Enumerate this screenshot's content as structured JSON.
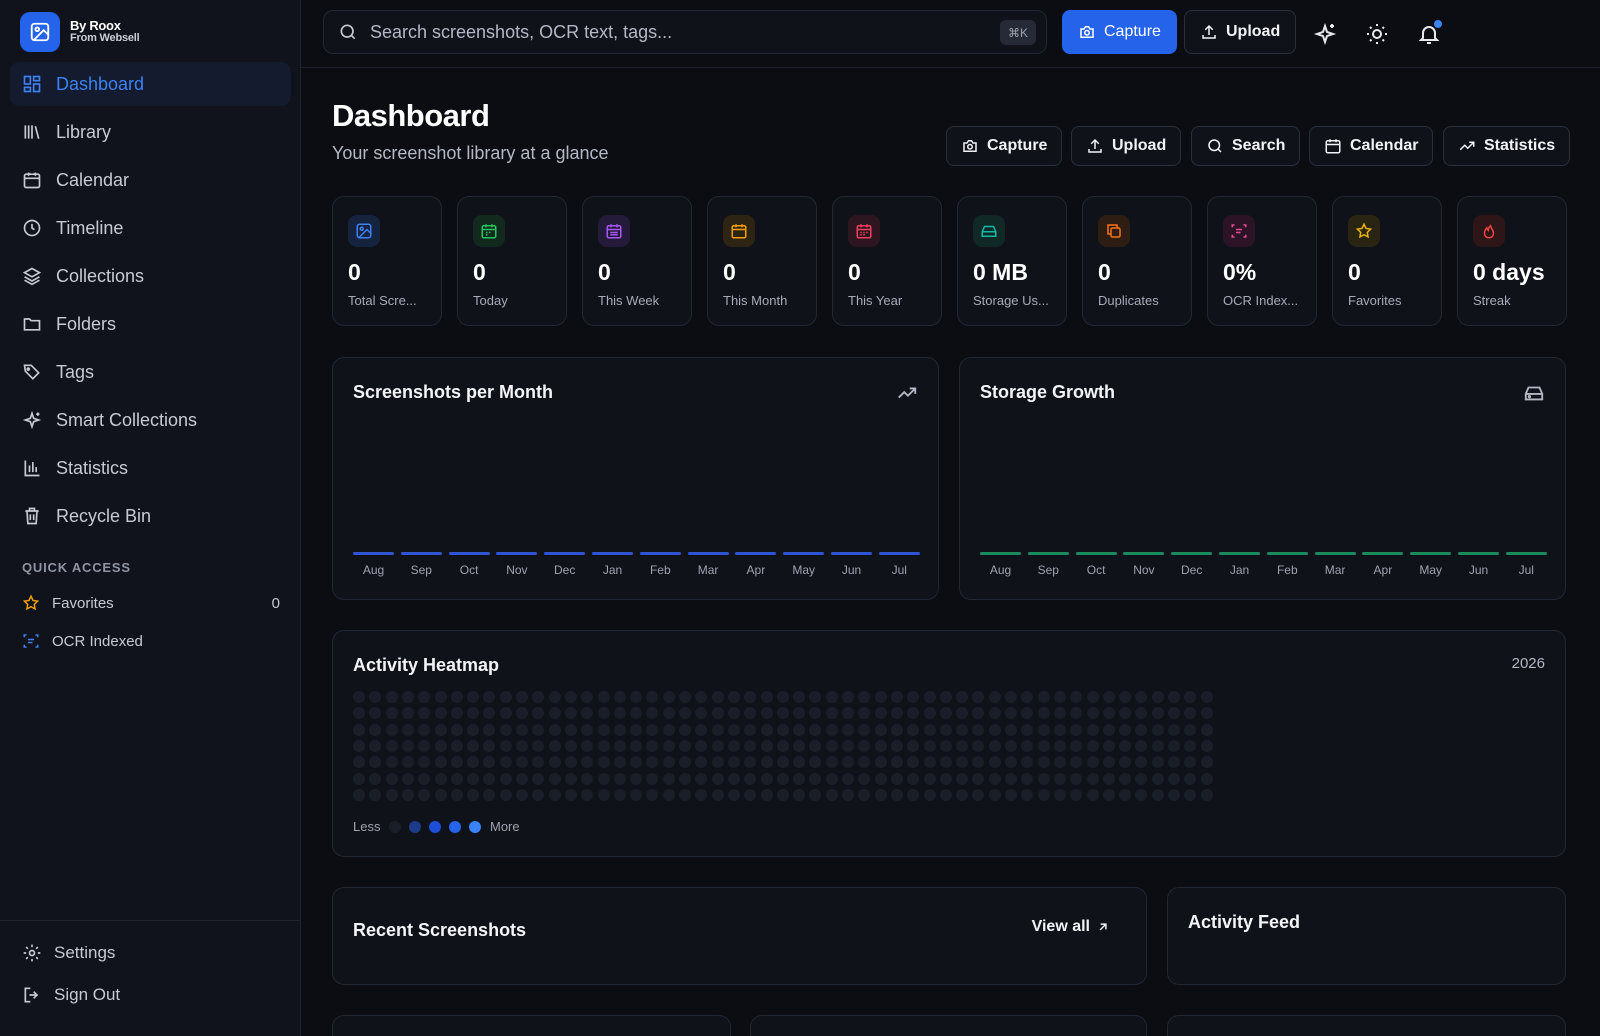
{
  "brand": {
    "name": "By Roox",
    "sub": "From Websell"
  },
  "nav": {
    "items": [
      {
        "label": "Dashboard",
        "icon": "dashboard-icon",
        "active": true
      },
      {
        "label": "Library",
        "icon": "library-icon"
      },
      {
        "label": "Calendar",
        "icon": "calendar-icon"
      },
      {
        "label": "Timeline",
        "icon": "clock-icon"
      },
      {
        "label": "Collections",
        "icon": "layers-icon"
      },
      {
        "label": "Folders",
        "icon": "folder-icon"
      },
      {
        "label": "Tags",
        "icon": "tags-icon"
      },
      {
        "label": "Smart Collections",
        "icon": "sparkles-icon"
      },
      {
        "label": "Statistics",
        "icon": "bar-chart-icon"
      },
      {
        "label": "Recycle Bin",
        "icon": "trash-icon"
      }
    ]
  },
  "quick_access": {
    "title": "QUICK ACCESS",
    "favorites": {
      "label": "Favorites",
      "count": "0"
    },
    "ocr": {
      "label": "OCR Indexed"
    }
  },
  "bottom": {
    "settings": "Settings",
    "signout": "Sign Out"
  },
  "topbar": {
    "search_placeholder": "Search screenshots, OCR text, tags...",
    "shortcut": "⌘K",
    "capture": "Capture",
    "upload": "Upload"
  },
  "header": {
    "title": "Dashboard",
    "subtitle": "Your screenshot library at a glance",
    "actions": [
      "Capture",
      "Upload",
      "Search",
      "Calendar",
      "Statistics"
    ]
  },
  "stats": [
    {
      "value": "0",
      "label": "Total Scre...",
      "color": "#3b82f6",
      "bg": "#16233f",
      "icon": "image-icon"
    },
    {
      "value": "0",
      "label": "Today",
      "color": "#22c55e",
      "bg": "#12291e",
      "icon": "calendar-today-icon"
    },
    {
      "value": "0",
      "label": "This Week",
      "color": "#a855f7",
      "bg": "#241a3a",
      "icon": "calendar-week-icon"
    },
    {
      "value": "0",
      "label": "This Month",
      "color": "#f59e0b",
      "bg": "#2e2413",
      "icon": "calendar-month-icon"
    },
    {
      "value": "0",
      "label": "This Year",
      "color": "#f43f5e",
      "bg": "#2e1620",
      "icon": "calendar-year-icon"
    },
    {
      "value": "0 MB",
      "label": "Storage Us...",
      "color": "#14b8a6",
      "bg": "#102826",
      "icon": "drive-icon"
    },
    {
      "value": "0",
      "label": "Duplicates",
      "color": "#f97316",
      "bg": "#2e1d13",
      "icon": "copy-icon"
    },
    {
      "value": "0%",
      "label": "OCR Index...",
      "color": "#ec4899",
      "bg": "#2c1426",
      "icon": "scan-icon"
    },
    {
      "value": "0",
      "label": "Favorites",
      "color": "#eab308",
      "bg": "#2a2512",
      "icon": "star-icon"
    },
    {
      "value": "0 days",
      "label": "Streak",
      "color": "#ef4444",
      "bg": "#2e1618",
      "icon": "flame-icon"
    }
  ],
  "charts": {
    "months": [
      "Aug",
      "Sep",
      "Oct",
      "Nov",
      "Dec",
      "Jan",
      "Feb",
      "Mar",
      "Apr",
      "May",
      "Jun",
      "Jul"
    ],
    "per_month_title": "Screenshots per Month",
    "storage_title": "Storage Growth",
    "per_month_color": "#2f55d4",
    "storage_color": "#1c8a5a"
  },
  "chart_data": [
    {
      "type": "bar",
      "title": "Screenshots per Month",
      "categories": [
        "Aug",
        "Sep",
        "Oct",
        "Nov",
        "Dec",
        "Jan",
        "Feb",
        "Mar",
        "Apr",
        "May",
        "Jun",
        "Jul"
      ],
      "values": [
        0,
        0,
        0,
        0,
        0,
        0,
        0,
        0,
        0,
        0,
        0,
        0
      ]
    },
    {
      "type": "bar",
      "title": "Storage Growth",
      "categories": [
        "Aug",
        "Sep",
        "Oct",
        "Nov",
        "Dec",
        "Jan",
        "Feb",
        "Mar",
        "Apr",
        "May",
        "Jun",
        "Jul"
      ],
      "values": [
        0,
        0,
        0,
        0,
        0,
        0,
        0,
        0,
        0,
        0,
        0,
        0
      ]
    }
  ],
  "heatmap": {
    "title": "Activity Heatmap",
    "year": "2026",
    "less": "Less",
    "more": "More",
    "legend_colors": [
      "#1a1e28",
      "#1e3a8a",
      "#1d4ed8",
      "#2563eb",
      "#3b82f6"
    ]
  },
  "recent": {
    "title": "Recent Screenshots",
    "view_all": "View all"
  },
  "activity": {
    "title": "Activity Feed"
  }
}
